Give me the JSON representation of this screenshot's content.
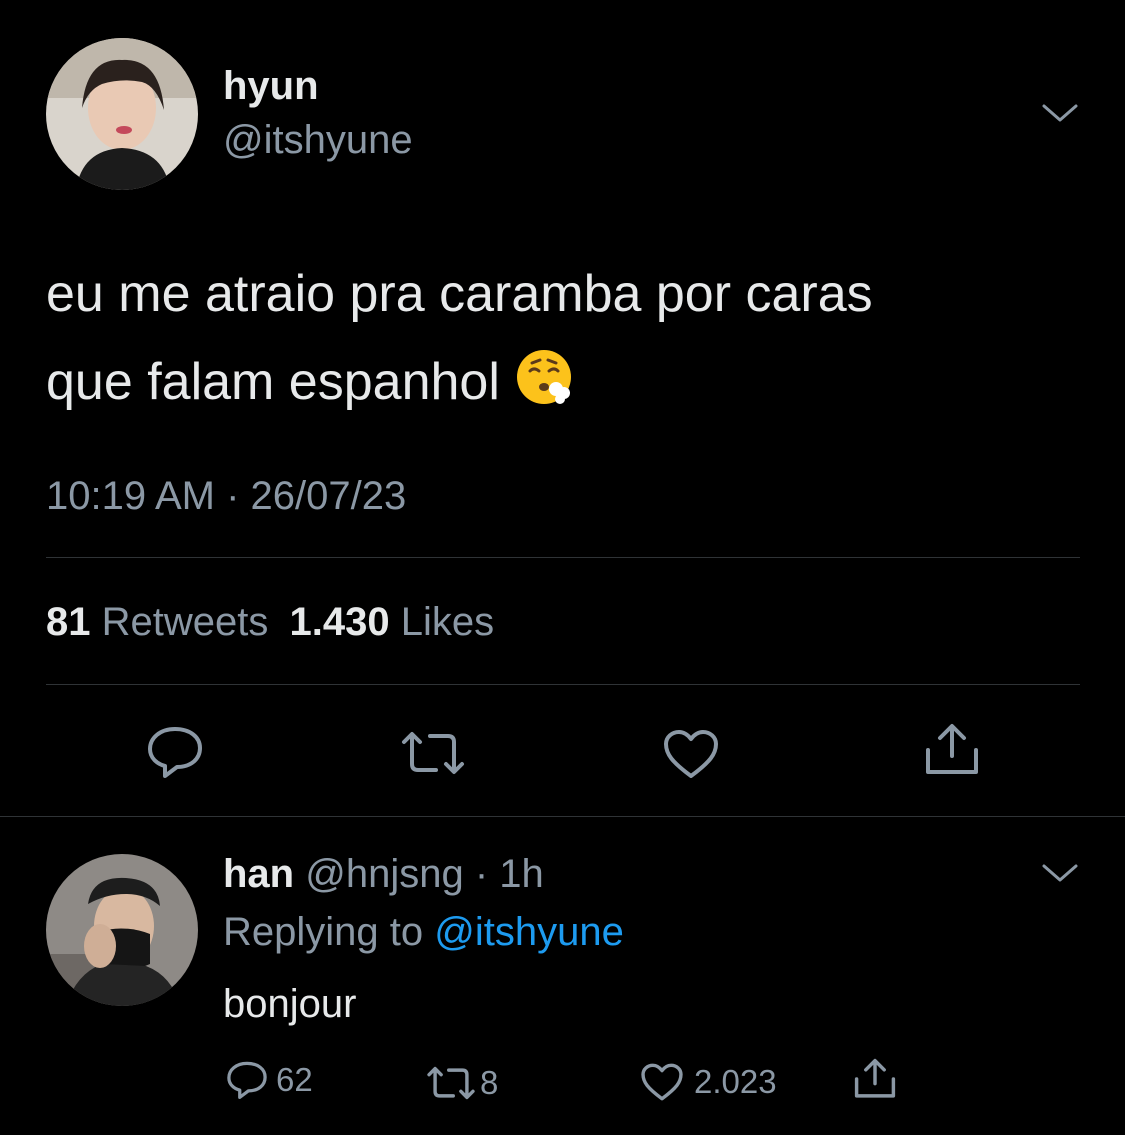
{
  "main_tweet": {
    "display_name": "hyun",
    "handle": "@itshyune",
    "text_line1": "eu me atraio pra caramba por caras",
    "text_line2": "que falam espanhol",
    "emoji": "😮‍💨",
    "timestamp": "10:19 AM · 26/07/23",
    "retweets_count": "81",
    "retweets_label": "Retweets",
    "likes_count": "1.430",
    "likes_label": "Likes"
  },
  "reply": {
    "display_name": "han",
    "handle_time": "@hnjsng · 1h",
    "replying_prefix": "Replying to",
    "replying_handle": "@itshyune",
    "text": "bonjour",
    "reply_count": "62",
    "retweet_count": "8",
    "like_count": "2.023"
  },
  "icons": [
    "chevron-down-icon",
    "reply-icon",
    "retweet-icon",
    "like-icon",
    "share-icon"
  ],
  "colors": {
    "background": "#000000",
    "primary_text": "#e7e9ea",
    "secondary_text": "#8b98a5",
    "link": "#1d9bf0",
    "divider": "#2f3336"
  }
}
